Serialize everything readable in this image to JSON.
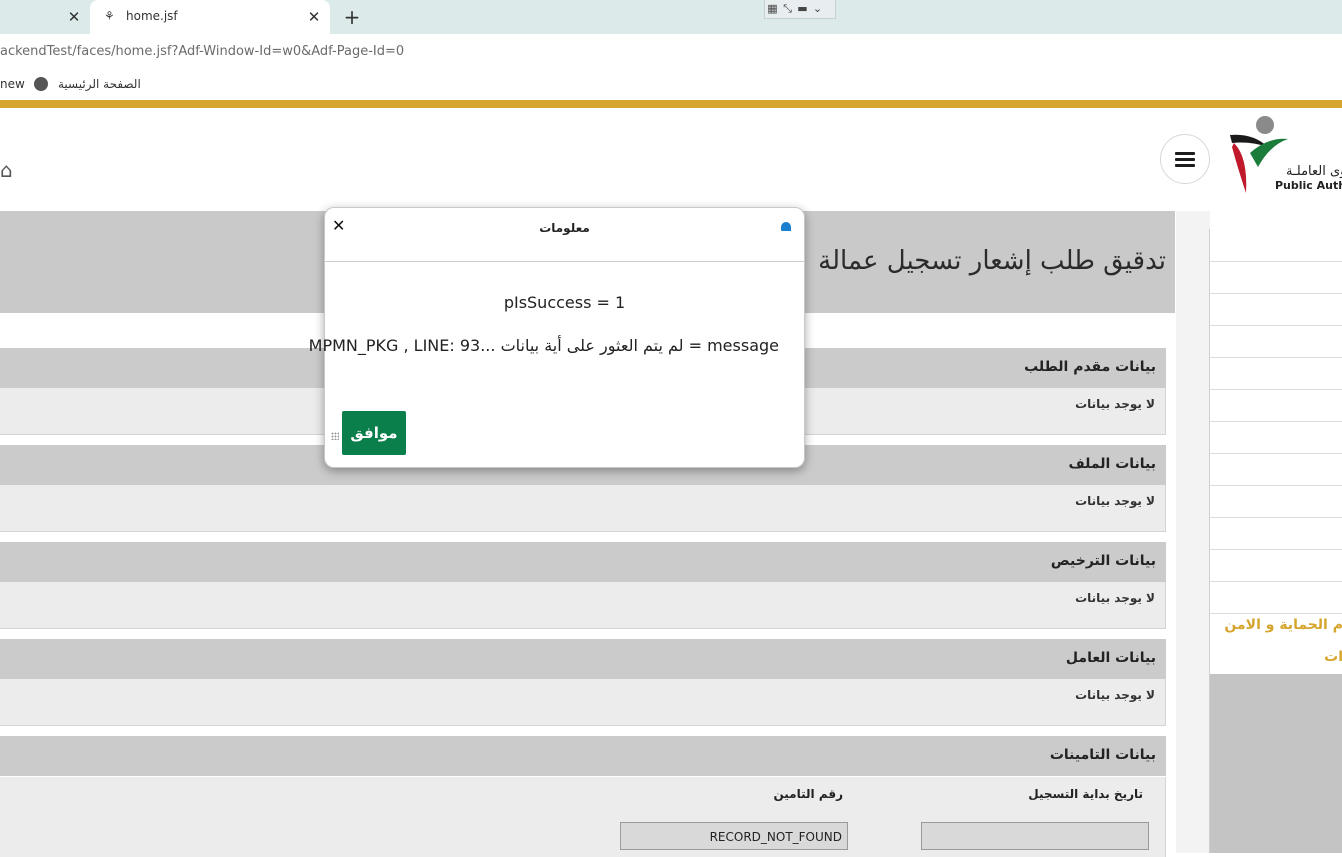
{
  "browser": {
    "tab_title": "home.jsf",
    "url": "ackendTest/faces/home.jsf?Adf-Window-Id=w0&Adf-Page-Id=0",
    "bookmarks": {
      "partial": "new",
      "home": "الصفحة الرئيسية"
    }
  },
  "header": {
    "logo_ar": "قـوى العاملـة",
    "logo_en": "Public Autho"
  },
  "page": {
    "title": "تدقيق طلب إشعار تسجيل عمالة"
  },
  "sections": [
    {
      "title": "بيانات مقدم الطلب",
      "empty": "لا يوجد بيانات"
    },
    {
      "title": "بيانات الملف",
      "empty": "لا يوجد بيانات"
    },
    {
      "title": "بيانات الترخيص",
      "empty": "لا يوجد بيانات"
    },
    {
      "title": "بيانات العامل",
      "empty": "لا يوجد بيانات"
    }
  ],
  "insurance": {
    "title": "بيانات التامينات",
    "col_start_date": "تاريخ بداية التسجيل",
    "col_number": "رقم التامين",
    "start_date_value": "",
    "number_value": "RECORD_NOT_FOUND"
  },
  "sidebar": {
    "link1": "م الحماية و الامن",
    "link2": "ات"
  },
  "modal": {
    "title": "معلومات",
    "line1": "pIsSuccess = 1",
    "line2": "MPMN_PKG , LINE: 93... لم يتم العثور على أية بيانات = message",
    "ok": "موافق"
  },
  "colors": {
    "gold": "#d6a52d",
    "ok_green": "#0a7e4b",
    "section_header": "#cbcbcb"
  }
}
